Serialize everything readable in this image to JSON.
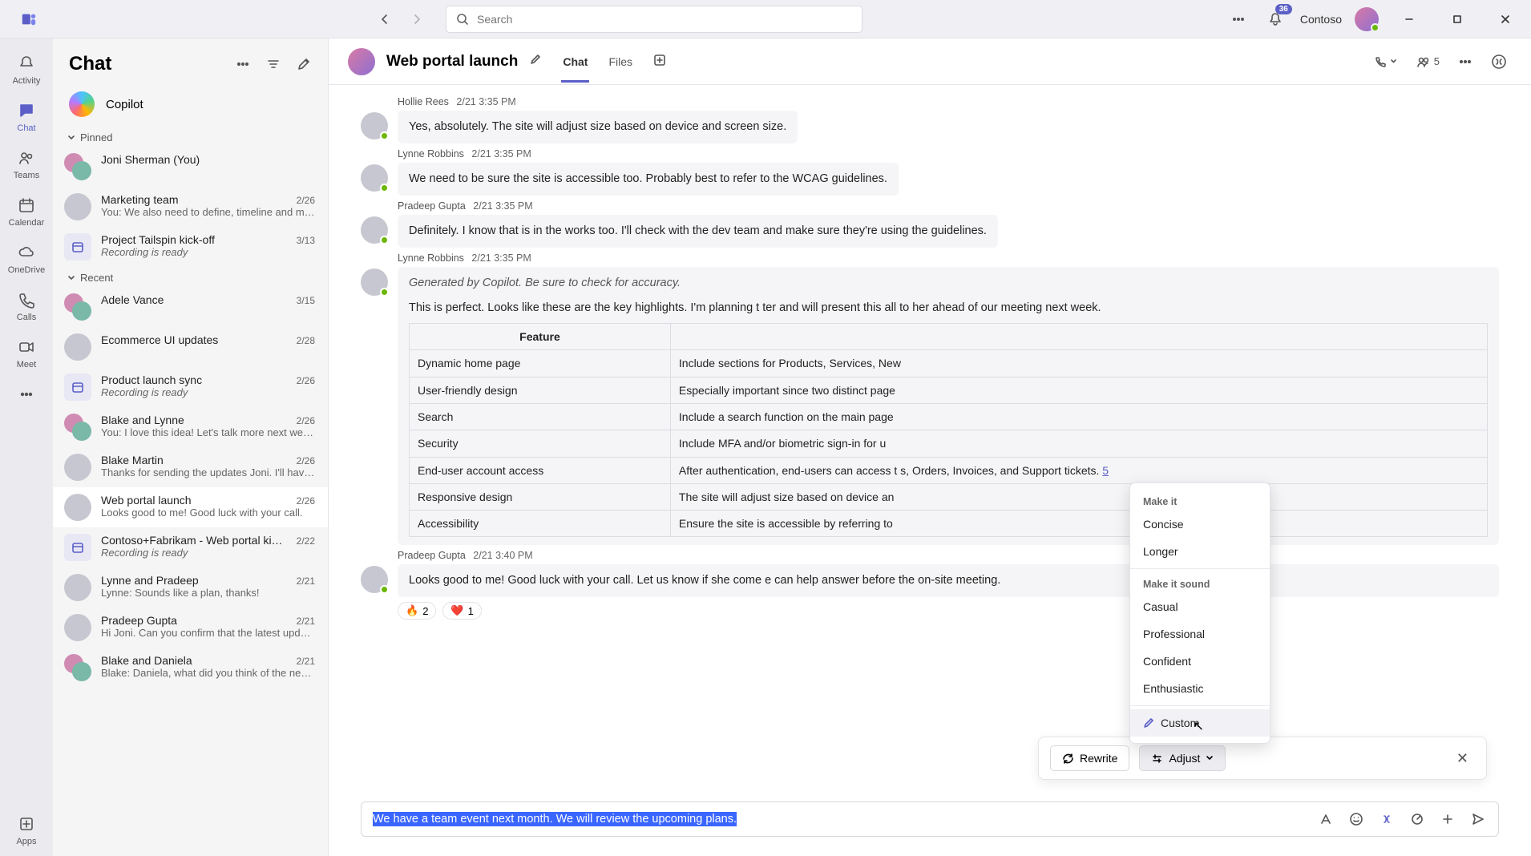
{
  "titlebar": {
    "search_placeholder": "Search",
    "notif_badge": "36",
    "org_name": "Contoso"
  },
  "rail": {
    "activity": "Activity",
    "chat": "Chat",
    "teams": "Teams",
    "calendar": "Calendar",
    "onedrive": "OneDrive",
    "calls": "Calls",
    "meet": "Meet",
    "apps": "Apps"
  },
  "chatlist": {
    "header": "Chat",
    "copilot": "Copilot",
    "section_pinned": "Pinned",
    "section_recent": "Recent",
    "items": [
      {
        "title": "Joni Sherman (You)",
        "date": "",
        "sub": ""
      },
      {
        "title": "Marketing team",
        "date": "2/26",
        "sub": "You: We also need to define, timeline and miles…"
      },
      {
        "title": "Project Tailspin kick-off",
        "date": "3/13",
        "sub": "Recording is ready",
        "italic": true,
        "cal": true
      },
      {
        "title": "Adele Vance",
        "date": "3/15",
        "sub": ""
      },
      {
        "title": "Ecommerce UI updates",
        "date": "2/28",
        "sub": ""
      },
      {
        "title": "Product launch sync",
        "date": "2/26",
        "sub": "Recording is ready",
        "italic": true,
        "cal": true
      },
      {
        "title": "Blake and Lynne",
        "date": "2/26",
        "sub": "You: I love this idea! Let's talk more next week."
      },
      {
        "title": "Blake Martin",
        "date": "2/26",
        "sub": "Thanks for sending the updates Joni. I'll have s…"
      },
      {
        "title": "Web portal launch",
        "date": "2/26",
        "sub": "Looks good to me! Good luck with your call.",
        "selected": true
      },
      {
        "title": "Contoso+Fabrikam - Web portal ki…",
        "date": "2/22",
        "sub": "Recording is ready",
        "italic": true,
        "cal": true
      },
      {
        "title": "Lynne and Pradeep",
        "date": "2/21",
        "sub": "Lynne: Sounds like a plan, thanks!"
      },
      {
        "title": "Pradeep Gupta",
        "date": "2/21",
        "sub": "Hi Joni. Can you confirm that the latest updates…"
      },
      {
        "title": "Blake and Daniela",
        "date": "2/21",
        "sub": "Blake: Daniela, what did you think of the new d…"
      }
    ]
  },
  "conversation": {
    "title": "Web portal launch",
    "tab_chat": "Chat",
    "tab_files": "Files",
    "people_count": "5",
    "messages": [
      {
        "author": "Hollie Rees",
        "ts": "2/21 3:35 PM",
        "text": "Yes, absolutely. The site will adjust size based on device and screen size."
      },
      {
        "author": "Lynne Robbins",
        "ts": "2/21 3:35 PM",
        "text": "We need to be sure the site is accessible too. Probably best to refer to the WCAG guidelines."
      },
      {
        "author": "Pradeep Gupta",
        "ts": "2/21 3:35 PM",
        "text": "Definitely. I know that is in the works too. I'll check with the dev team and make sure they're using the guidelines."
      }
    ],
    "copilot_msg": {
      "author": "Lynne Robbins",
      "ts": "2/21 3:35 PM",
      "note": "Generated by Copilot. Be sure to check for accuracy.",
      "body": "This is perfect. Looks like these are the key highlights. I'm planning t                                                      ter and will present this all to her ahead of our meeting next week.",
      "table_header": "Feature",
      "table": [
        {
          "f": "Dynamic home page",
          "d": "Include sections for Products, Services, New"
        },
        {
          "f": "User-friendly design",
          "d": "Especially important since two distinct page"
        },
        {
          "f": "Search",
          "d": "Include a search function on the main page"
        },
        {
          "f": "Security",
          "d": "Include MFA and/or biometric sign-in for u"
        },
        {
          "f": "End-user account access",
          "d": "After authentication, end-users can access t                              s, Orders, Invoices, and Support tickets. "
        },
        {
          "f": "Responsive design",
          "d": "The site will adjust size based on device an"
        },
        {
          "f": "Accessibility",
          "d": "Ensure the site is accessible by referring to"
        }
      ],
      "table_link": "5"
    },
    "last_msg": {
      "author": "Pradeep Gupta",
      "ts": "2/21 3:40 PM",
      "text": "Looks good to me! Good luck with your call. Let us know if she come                                        e can help answer before the on-site meeting.",
      "react_fire": "2",
      "react_heart": "1"
    }
  },
  "copilot_bar": {
    "rewrite": "Rewrite",
    "adjust": "Adjust"
  },
  "adjust_menu": {
    "hdr1": "Make it",
    "concise": "Concise",
    "longer": "Longer",
    "hdr2": "Make it sound",
    "casual": "Casual",
    "professional": "Professional",
    "confident": "Confident",
    "enthusiastic": "Enthusiastic",
    "custom": "Custom"
  },
  "compose": {
    "text": "We have a team event next month. We will review the upcoming plans."
  }
}
